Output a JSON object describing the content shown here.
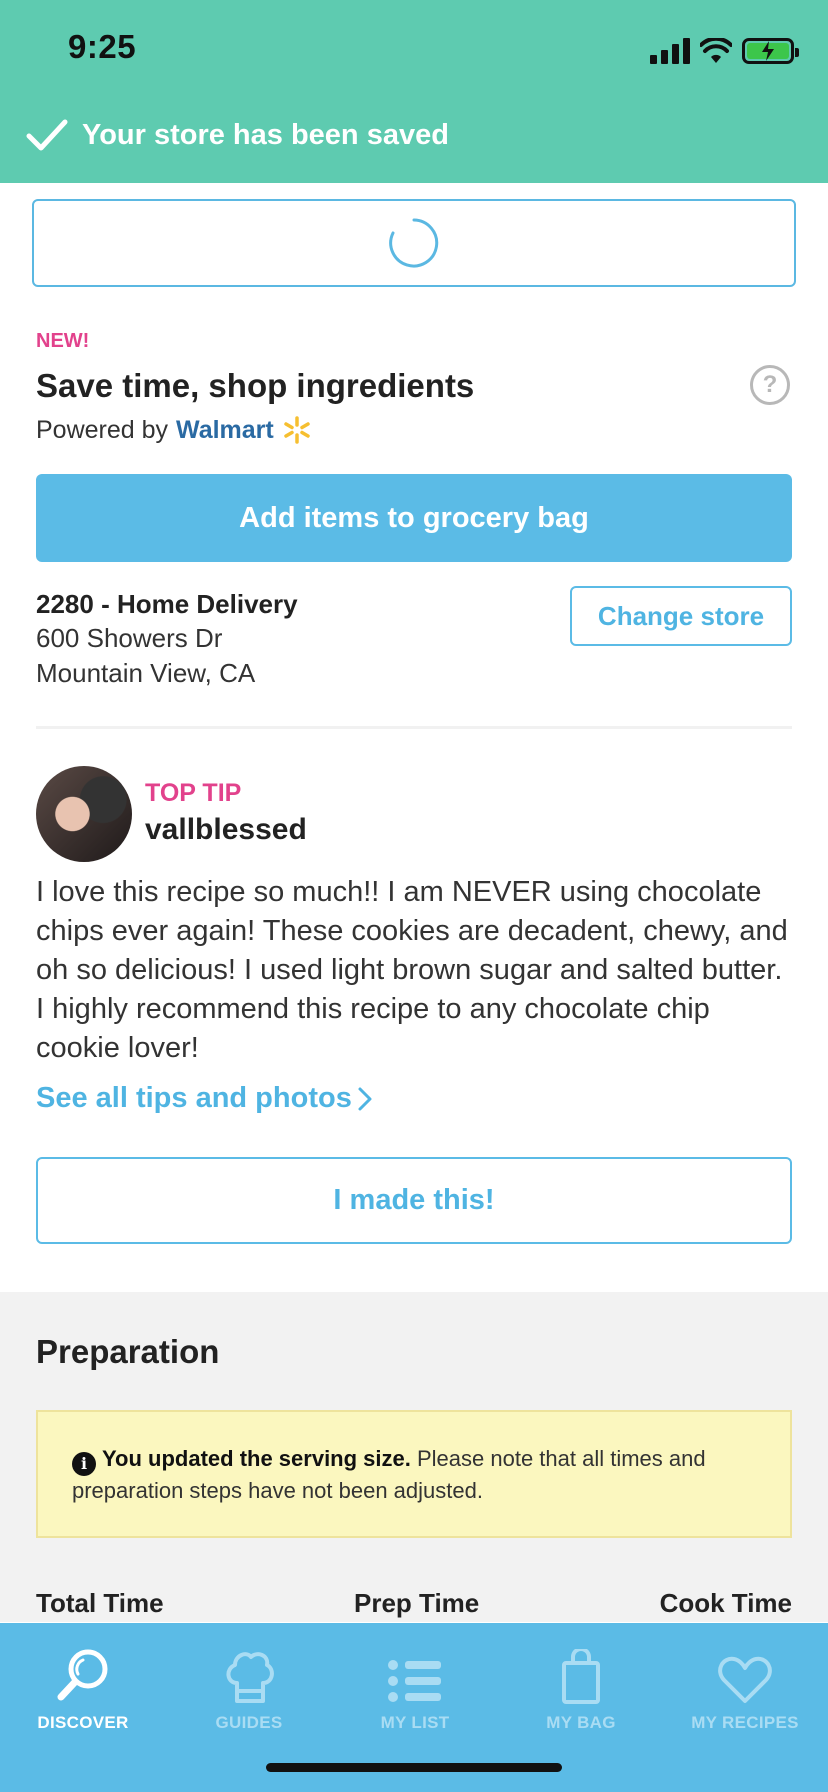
{
  "status_bar": {
    "time": "9:25"
  },
  "banner": {
    "message": "Your store has been saved"
  },
  "shop": {
    "new_label": "NEW!",
    "title": "Save time, shop ingredients",
    "powered_by": "Powered by",
    "partner": "Walmart",
    "add_button": "Add items to grocery bag",
    "help": "?"
  },
  "store": {
    "name": "2280 - Home Delivery",
    "address_line1": "600 Showers Dr",
    "address_line2": "Mountain View, CA",
    "change_button": "Change store"
  },
  "tip": {
    "label": "TOP TIP",
    "username": "vallblessed",
    "text": "I love this recipe so much!! I am NEVER using chocolate chips ever again! These cookies are decadent, chewy, and oh so delicious! I used light brown sugar and salted butter. I highly recommend this recipe to any chocolate chip cookie lover!",
    "see_all": "See all tips and photos",
    "made_button": "I made this!"
  },
  "preparation": {
    "title": "Preparation",
    "note_bold": "You updated the serving size.",
    "note_text": " Please note that all times and preparation steps have not been adjusted.",
    "total_time_label": "Total Time",
    "prep_time_label": "Prep Time",
    "cook_time_label": "Cook Time"
  },
  "tabs": [
    {
      "label": "DISCOVER",
      "icon": "search-icon",
      "active": true
    },
    {
      "label": "GUIDES",
      "icon": "chef-hat-icon",
      "active": false
    },
    {
      "label": "MY LIST",
      "icon": "list-icon",
      "active": false
    },
    {
      "label": "MY BAG",
      "icon": "bag-icon",
      "active": false
    },
    {
      "label": "MY RECIPES",
      "icon": "heart-icon",
      "active": false
    }
  ],
  "colors": {
    "banner": "#5ecbb0",
    "accent_blue": "#5bbbe6",
    "pink": "#e2428c",
    "tab_inactive": "#a9dcf3",
    "note_bg": "#fbf7bf"
  }
}
